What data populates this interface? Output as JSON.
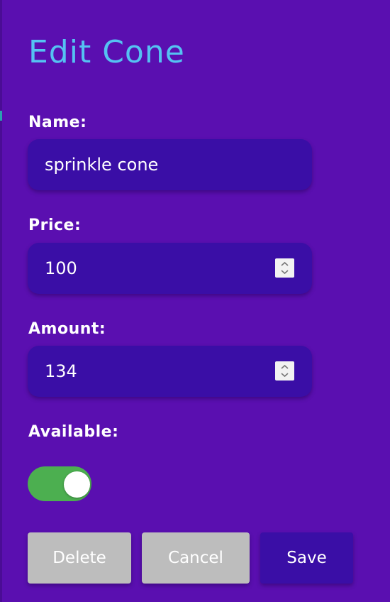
{
  "form": {
    "title": "Edit Cone",
    "name_label": "Name:",
    "name_value": "sprinkle cone",
    "price_label": "Price:",
    "price_value": "100",
    "amount_label": "Amount:",
    "amount_value": "134",
    "available_label": "Available:",
    "available_on": true
  },
  "actions": {
    "delete_label": "Delete",
    "cancel_label": "Cancel",
    "save_label": "Save"
  },
  "colors": {
    "background": "#5a0fb0",
    "field": "#3a0ea6",
    "title": "#55c2f2",
    "toggle_on": "#4caf50",
    "button_grey": "#bdbdbd"
  }
}
